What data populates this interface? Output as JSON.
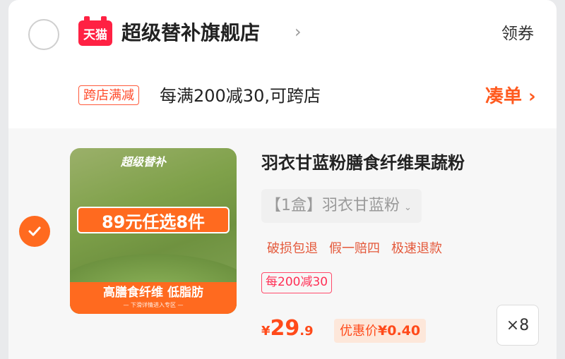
{
  "shop": {
    "badge": "天猫",
    "name": "超级替补旗舰店",
    "chevron": "›",
    "coupon_label": "领券"
  },
  "promo": {
    "tag": "跨店满减",
    "text": "每满200减30,可跨店",
    "action": "凑单 ›"
  },
  "item": {
    "selected": true,
    "image": {
      "logo": "超级替补",
      "banner": "89元任选8件",
      "footer_main": "高膳食纤维 低脂肪",
      "footer_sub": "— 下滑详情进入专区 —"
    },
    "title": "羽衣甘蓝粉膳食纤维果蔬粉",
    "sku": "【1盒】羽衣甘蓝粉",
    "sku_icon": "chevron-down-icon",
    "services": [
      "破损包退",
      "假一赔四",
      "极速退款"
    ],
    "discount_tag": "每200减30",
    "price_symbol": "¥",
    "price_int": "29",
    "price_dec": ".9",
    "deal_label": "优惠价",
    "deal_amount": "¥0.40",
    "quantity": "×8"
  },
  "colors": {
    "accent": "#ff6a1f",
    "tmall_red": "#ff2143",
    "price": "#ff4a1a"
  }
}
